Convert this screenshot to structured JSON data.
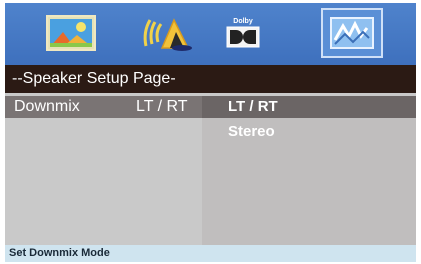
{
  "tabs": [
    {
      "icon": "landscape-picture-icon",
      "active": false
    },
    {
      "icon": "speaker-sound-icon",
      "active": false
    },
    {
      "icon": "dolby-icon",
      "label": "Dolby",
      "active": false
    },
    {
      "icon": "preferences-icon",
      "active": true
    }
  ],
  "header": {
    "title": "--Speaker Setup Page-"
  },
  "setting": {
    "label": "Downmix",
    "value": "LT / RT"
  },
  "options": [
    "LT / RT",
    "Stereo"
  ],
  "status": {
    "text": "Set Downmix Mode"
  },
  "colors": {
    "tab_bar": "#4a7ec8",
    "header_bg": "#2b1a14",
    "content_bg": "#c9c9c9",
    "highlight": "#7a7474",
    "status_bg": "#cfe4ef"
  }
}
